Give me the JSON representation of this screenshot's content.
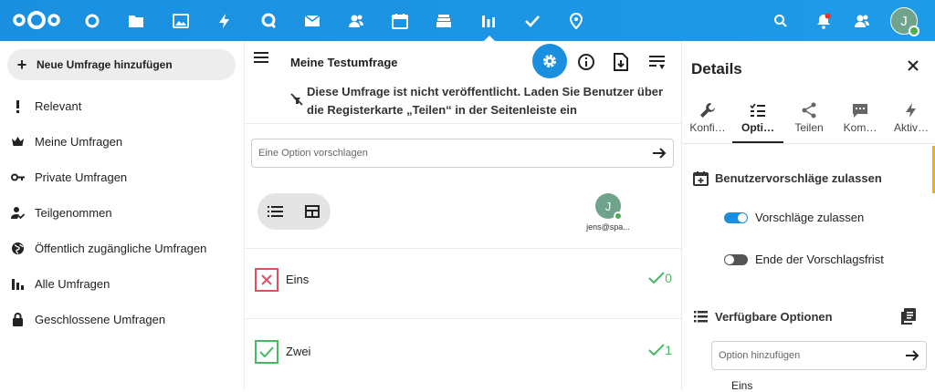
{
  "topbar": {
    "apps": [
      "dashboard-icon",
      "files-icon",
      "photos-icon",
      "activity-icon",
      "talk-icon",
      "mail-icon",
      "contacts-icon",
      "calendar-icon",
      "deck-icon",
      "polls-icon",
      "tasks-icon",
      "maps-icon"
    ],
    "right": [
      "search-icon",
      "notifications-icon",
      "contacts-menu-icon"
    ],
    "avatar_initial": "J",
    "brand_color": "#1a8fe0"
  },
  "sidebar": {
    "new_poll": "Neue Umfrage hinzufügen",
    "items": [
      {
        "label": "Relevant",
        "icon": "exclamation-icon"
      },
      {
        "label": "Meine Umfragen",
        "icon": "crown-icon"
      },
      {
        "label": "Private Umfragen",
        "icon": "key-icon"
      },
      {
        "label": "Teilgenommen",
        "icon": "user-check-icon"
      },
      {
        "label": "Öffentlich zugängliche Umfragen",
        "icon": "globe-icon"
      },
      {
        "label": "Alle Umfragen",
        "icon": "bar-chart-icon"
      },
      {
        "label": "Geschlossene Umfragen",
        "icon": "lock-icon"
      }
    ]
  },
  "main": {
    "title": "Meine Testumfrage",
    "notice": "Diese Umfrage ist nicht veröffentlicht. Laden Sie Benutzer über die Registerkarte „Teilen“ in der Seitenleiste ein",
    "propose_placeholder": "Eine Option vorschlagen",
    "participant": {
      "initial": "J",
      "name": "jens@spa..."
    },
    "options": [
      {
        "label": "Eins",
        "state": "no",
        "count": "0"
      },
      {
        "label": "Zwei",
        "state": "yes",
        "count": "1"
      }
    ]
  },
  "details": {
    "title": "Details",
    "tabs": [
      {
        "label": "Konfi…",
        "icon": "wrench-icon"
      },
      {
        "label": "Opti…",
        "icon": "options-list-icon",
        "active": true
      },
      {
        "label": "Teilen",
        "icon": "share-icon"
      },
      {
        "label": "Kom…",
        "icon": "comment-icon"
      },
      {
        "label": "Aktiv…",
        "icon": "activity-icon"
      }
    ],
    "section_suggestions": "Benutzervorschläge zulassen",
    "toggle_allow": "Vorschläge zulassen",
    "toggle_deadline": "Ende der Vorschlagsfrist",
    "section_options": "Verfügbare Optionen",
    "add_option_placeholder": "Option hinzufügen",
    "first_option": "Eins"
  }
}
